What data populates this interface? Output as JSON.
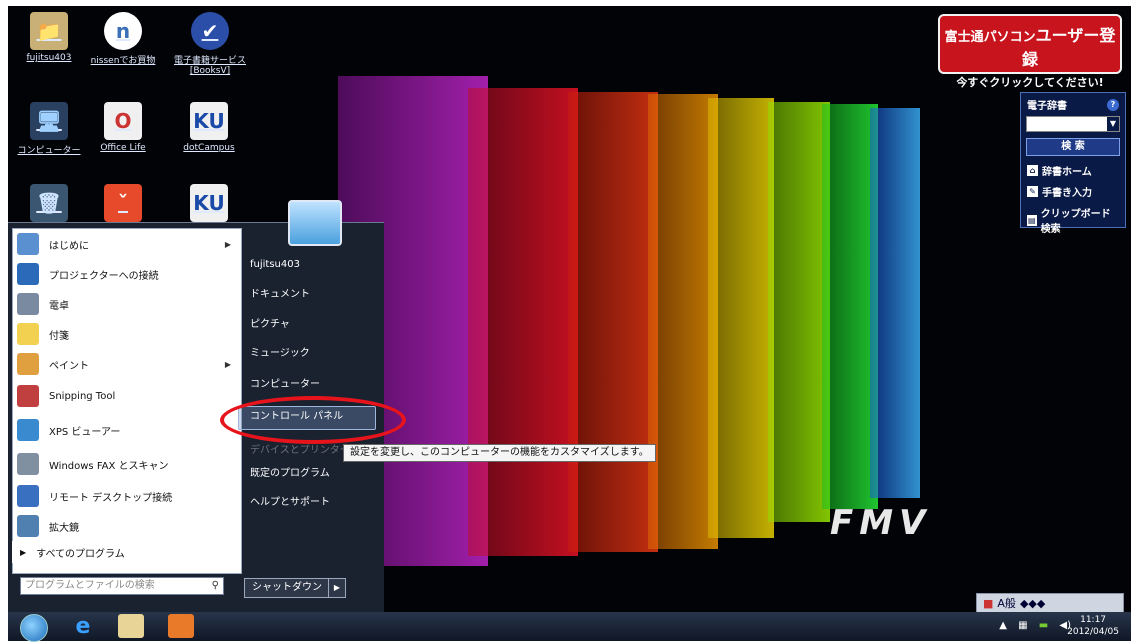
{
  "desktop_icons": [
    {
      "label": "fujitsu403",
      "glyph": "📁",
      "color": "#c9b076"
    },
    {
      "label": "nissenでお買物",
      "glyph": "n",
      "color": "#3b6fb8"
    },
    {
      "label": "電子書籍サービス [BooksV]",
      "glyph": "✔",
      "color": "#2b4fa8"
    },
    {
      "label": "コンピューター",
      "glyph": "🖥",
      "color": "#6aa0d8"
    },
    {
      "label": "Office Life",
      "glyph": "O",
      "color": "#e9e9e9"
    },
    {
      "label": "dotCampus",
      "glyph": "KU",
      "color": "#f0f0f0"
    },
    {
      "label": "",
      "glyph": "🗑",
      "color": "#6a8caf"
    },
    {
      "label": "",
      "glyph": "ˇ",
      "color": "#e64a2a"
    },
    {
      "label": "",
      "glyph": "KU",
      "color": "#f0f0f0"
    }
  ],
  "registration_banner": {
    "line1_prefix": "富士通パソコン",
    "line1_main": "ユーザー登録",
    "line2": "今すぐクリックしてください!"
  },
  "dictionary": {
    "title": "電子辞書",
    "search_label": "検 索",
    "items": [
      "辞書ホーム",
      "手書き入力",
      "クリップボード検索"
    ]
  },
  "fmv_logo": "FMV",
  "start_menu": {
    "programs": [
      {
        "label": "はじめに",
        "has_arrow": true,
        "color": "#5a8fd0"
      },
      {
        "label": "プロジェクターへの接続",
        "has_arrow": false,
        "color": "#2a6ab8"
      },
      {
        "label": "電卓",
        "has_arrow": false,
        "color": "#7a8aa0"
      },
      {
        "label": "付箋",
        "has_arrow": false,
        "color": "#f2d050"
      },
      {
        "label": "ペイント",
        "has_arrow": true,
        "color": "#e0a040"
      },
      {
        "label": "Snipping Tool",
        "has_arrow": false,
        "color": "#c04040"
      },
      {
        "label": "XPS ビューアー",
        "has_arrow": false,
        "color": "#3a8ad0"
      },
      {
        "label": "Windows FAX とスキャン",
        "has_arrow": false,
        "color": "#8090a0"
      },
      {
        "label": "リモート デスクトップ接続",
        "has_arrow": false,
        "color": "#3a70c0"
      },
      {
        "label": "拡大鏡",
        "has_arrow": false,
        "color": "#5080b0"
      }
    ],
    "all_programs": "すべてのプログラム",
    "search_placeholder": "プログラムとファイルの検索",
    "right_items": [
      "fujitsu403",
      "ドキュメント",
      "ピクチャ",
      "ミュージック",
      "コンピューター",
      "コントロール パネル",
      "デバイスとプリンター",
      "既定のプログラム",
      "ヘルプとサポート"
    ],
    "shutdown_label": "シャットダウン",
    "tooltip": "設定を変更し、このコンピューターの機能をカスタマイズします。"
  },
  "language_bar": "A般",
  "clock": {
    "time": "11:17",
    "date": "2012/04/05"
  },
  "colors": {
    "panel_colors": [
      "#c21ec8",
      "#e0143c",
      "#ff2a10",
      "#ff8a00",
      "#ffd400",
      "#9bff00",
      "#18e418",
      "#1a7aff"
    ]
  }
}
